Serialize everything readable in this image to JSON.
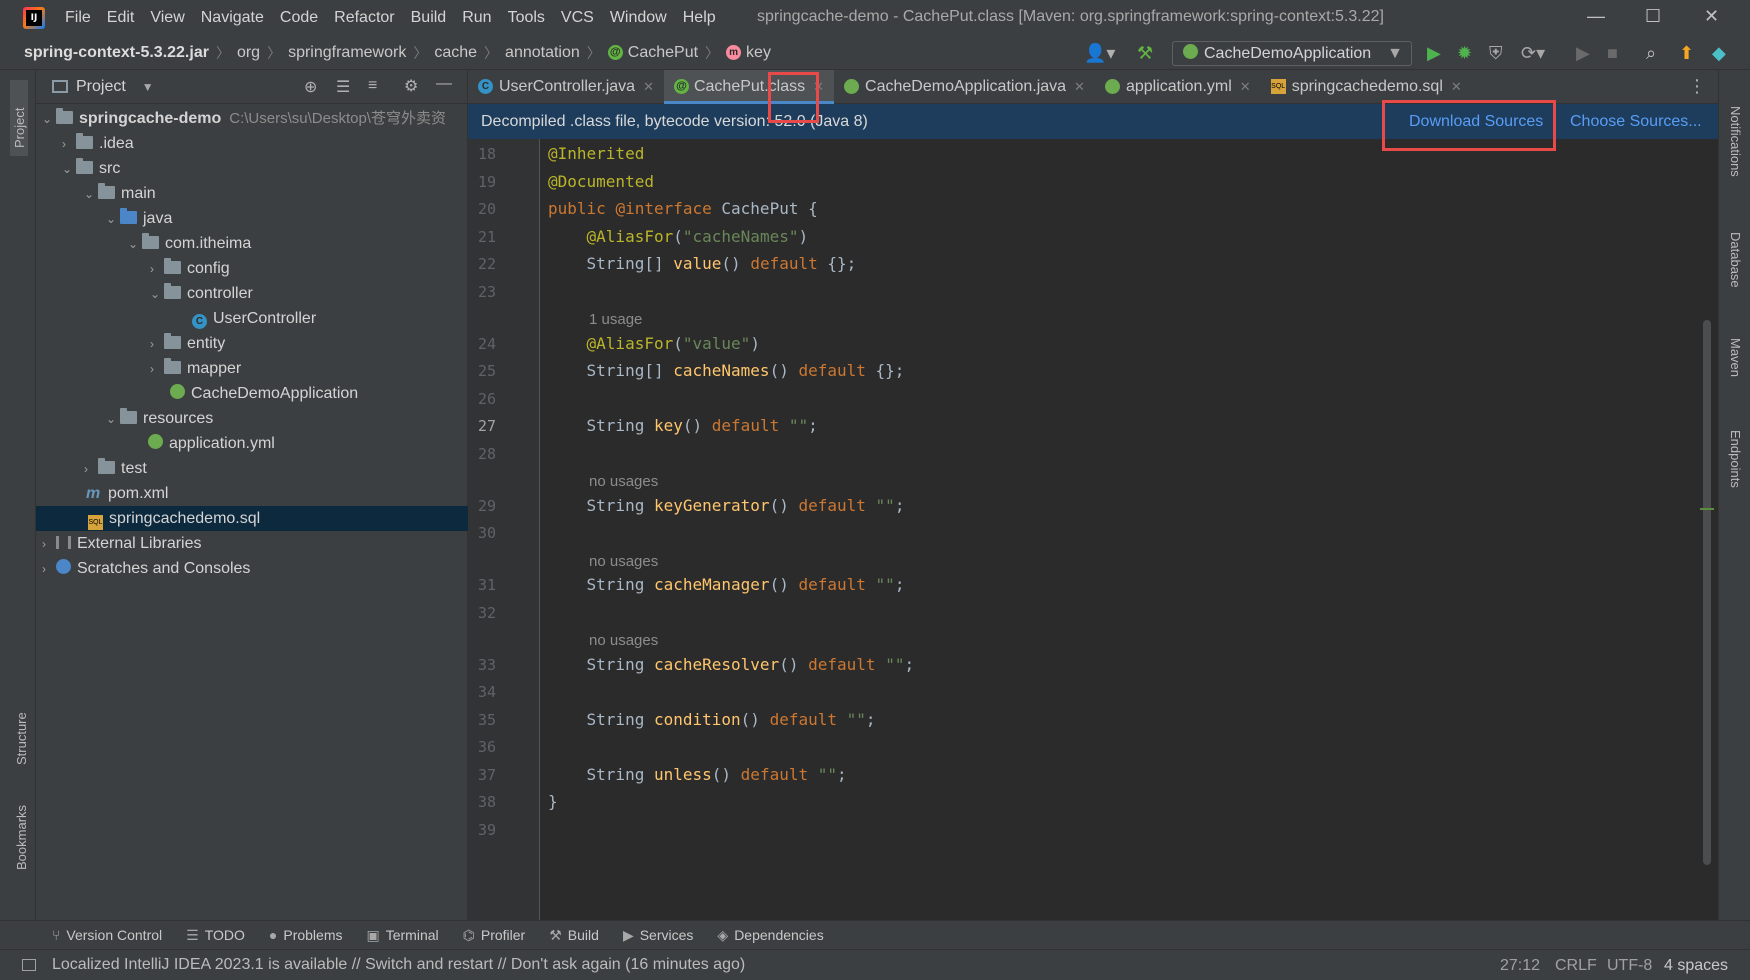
{
  "menu": [
    "File",
    "Edit",
    "View",
    "Navigate",
    "Code",
    "Refactor",
    "Build",
    "Run",
    "Tools",
    "VCS",
    "Window",
    "Help"
  ],
  "window_title": "springcache-demo - CachePut.class [Maven: org.springframework:spring-context:5.3.22]",
  "breadcrumb": {
    "jar": "spring-context-5.3.22.jar",
    "p1": "org",
    "p2": "springframework",
    "p3": "cache",
    "p4": "annotation",
    "cls": "CachePut",
    "member": "key"
  },
  "run_config": "CacheDemoApplication",
  "project_panel": {
    "title": "Project",
    "root": "springcache-demo",
    "root_path": "C:\\Users\\su\\Desktop\\苍穹外卖资",
    "items": {
      "idea": ".idea",
      "src": "src",
      "main": "main",
      "java": "java",
      "pkg": "com.itheima",
      "config": "config",
      "controller": "controller",
      "usercontroller": "UserController",
      "entity": "entity",
      "mapper": "mapper",
      "app": "CacheDemoApplication",
      "resources": "resources",
      "yml": "application.yml",
      "test": "test",
      "pom": "pom.xml",
      "sql": "springcachedemo.sql",
      "libs": "External Libraries",
      "scratches": "Scratches and Consoles"
    }
  },
  "tabs": [
    {
      "label": "UserController.java"
    },
    {
      "label": "CachePut.class"
    },
    {
      "label": "CacheDemoApplication.java"
    },
    {
      "label": "application.yml"
    },
    {
      "label": "springcachedemo.sql"
    }
  ],
  "banner": {
    "text": "Decompiled .class file, bytecode version: 52.0 (Java 8)",
    "download": "Download Sources",
    "choose": "Choose Sources..."
  },
  "code_lines": [
    {
      "n": "18",
      "t": "@Inherited"
    },
    {
      "n": "19",
      "t": "@Documented"
    },
    {
      "n": "20",
      "t": "public @interface CachePut {"
    },
    {
      "n": "21",
      "t": "    @AliasFor(\"cacheNames\")"
    },
    {
      "n": "22",
      "t": "    String[] value() default {};"
    },
    {
      "n": "23",
      "t": ""
    },
    {
      "n": "24",
      "t": "    @AliasFor(\"value\")"
    },
    {
      "n": "25",
      "t": "    String[] cacheNames() default {};"
    },
    {
      "n": "26",
      "t": ""
    },
    {
      "n": "27",
      "t": "    String key() default \"\";"
    },
    {
      "n": "28",
      "t": ""
    },
    {
      "n": "29",
      "t": "    String keyGenerator() default \"\";"
    },
    {
      "n": "30",
      "t": ""
    },
    {
      "n": "31",
      "t": "    String cacheManager() default \"\";"
    },
    {
      "n": "32",
      "t": ""
    },
    {
      "n": "33",
      "t": "    String cacheResolver() default \"\";"
    },
    {
      "n": "34",
      "t": ""
    },
    {
      "n": "35",
      "t": "    String condition() default \"\";"
    },
    {
      "n": "36",
      "t": ""
    },
    {
      "n": "37",
      "t": "    String unless() default \"\";"
    },
    {
      "n": "38",
      "t": "}"
    },
    {
      "n": "39",
      "t": ""
    }
  ],
  "inlay_hints": {
    "h24": "1 usage",
    "h29": "no usages",
    "h31": "no usages",
    "h33": "no usages"
  },
  "left_strip": {
    "project": "Project",
    "structure": "Structure",
    "bookmarks": "Bookmarks"
  },
  "right_strip": {
    "notifications": "Notifications",
    "database": "Database",
    "maven": "Maven",
    "endpoints": "Endpoints"
  },
  "bottom_tools": [
    "Version Control",
    "TODO",
    "Problems",
    "Terminal",
    "Profiler",
    "Build",
    "Services",
    "Dependencies"
  ],
  "status": {
    "message": "Localized IntelliJ IDEA 2023.1 is available // Switch and restart // Don't ask again (16 minutes ago)",
    "position": "27:12",
    "line_sep": "CRLF",
    "encoding": "UTF-8",
    "indent": "4 spaces"
  },
  "colors": {
    "highlight_box": "#e84a4a",
    "link": "#589df6",
    "banner_bg": "#1e3d5c"
  }
}
